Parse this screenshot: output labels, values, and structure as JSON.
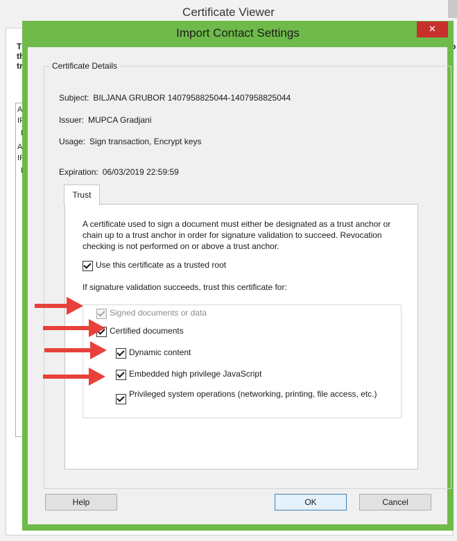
{
  "background_window": {
    "title": "Certificate Viewer",
    "left_fragments": [
      "T",
      "th",
      "tr",
      "A",
      "IF",
      "E",
      "A",
      "IF",
      "E"
    ],
    "right_fragment": "o"
  },
  "dialog": {
    "title": "Import Contact Settings",
    "close_label": "✕",
    "accent_color": "#6fba4a",
    "close_color": "#c7302b"
  },
  "details": {
    "legend": "Certificate Details",
    "subject_label": "Subject:",
    "subject_value": "BILJANA GRUBOR 1407958825044-1407958825044",
    "issuer_label": "Issuer:",
    "issuer_value": "MUPCA Gradjani",
    "usage_label": "Usage:",
    "usage_value": "Sign transaction, Encrypt keys",
    "expiration_label": "Expiration:",
    "expiration_value": "06/03/2019 22:59:59"
  },
  "tabs": [
    {
      "label": "Trust",
      "selected": true
    }
  ],
  "trust": {
    "description": "A certificate used to sign a document must either be designated as a trust anchor or chain up to a trust anchor in order for signature validation to succeed.  Revocation checking is not performed on or above a trust anchor.",
    "trusted_root_label": "Use this certificate as a trusted root",
    "trusted_root_checked": true,
    "trust_for_label": "If signature validation succeeds, trust this certificate for:",
    "options": [
      {
        "label": "Signed documents or data",
        "checked": true,
        "disabled": true
      },
      {
        "label": "Certified documents",
        "checked": true,
        "disabled": false
      },
      {
        "label": "Dynamic content",
        "checked": true,
        "disabled": false
      },
      {
        "label": "Embedded high privilege JavaScript",
        "checked": true,
        "disabled": false
      },
      {
        "label": "Privileged system operations (networking, printing, file access, etc.)",
        "checked": true,
        "disabled": false
      }
    ]
  },
  "annotations": {
    "arrow_color": "#e8403a"
  },
  "buttons": {
    "help": "Help",
    "ok": "OK",
    "cancel": "Cancel"
  }
}
